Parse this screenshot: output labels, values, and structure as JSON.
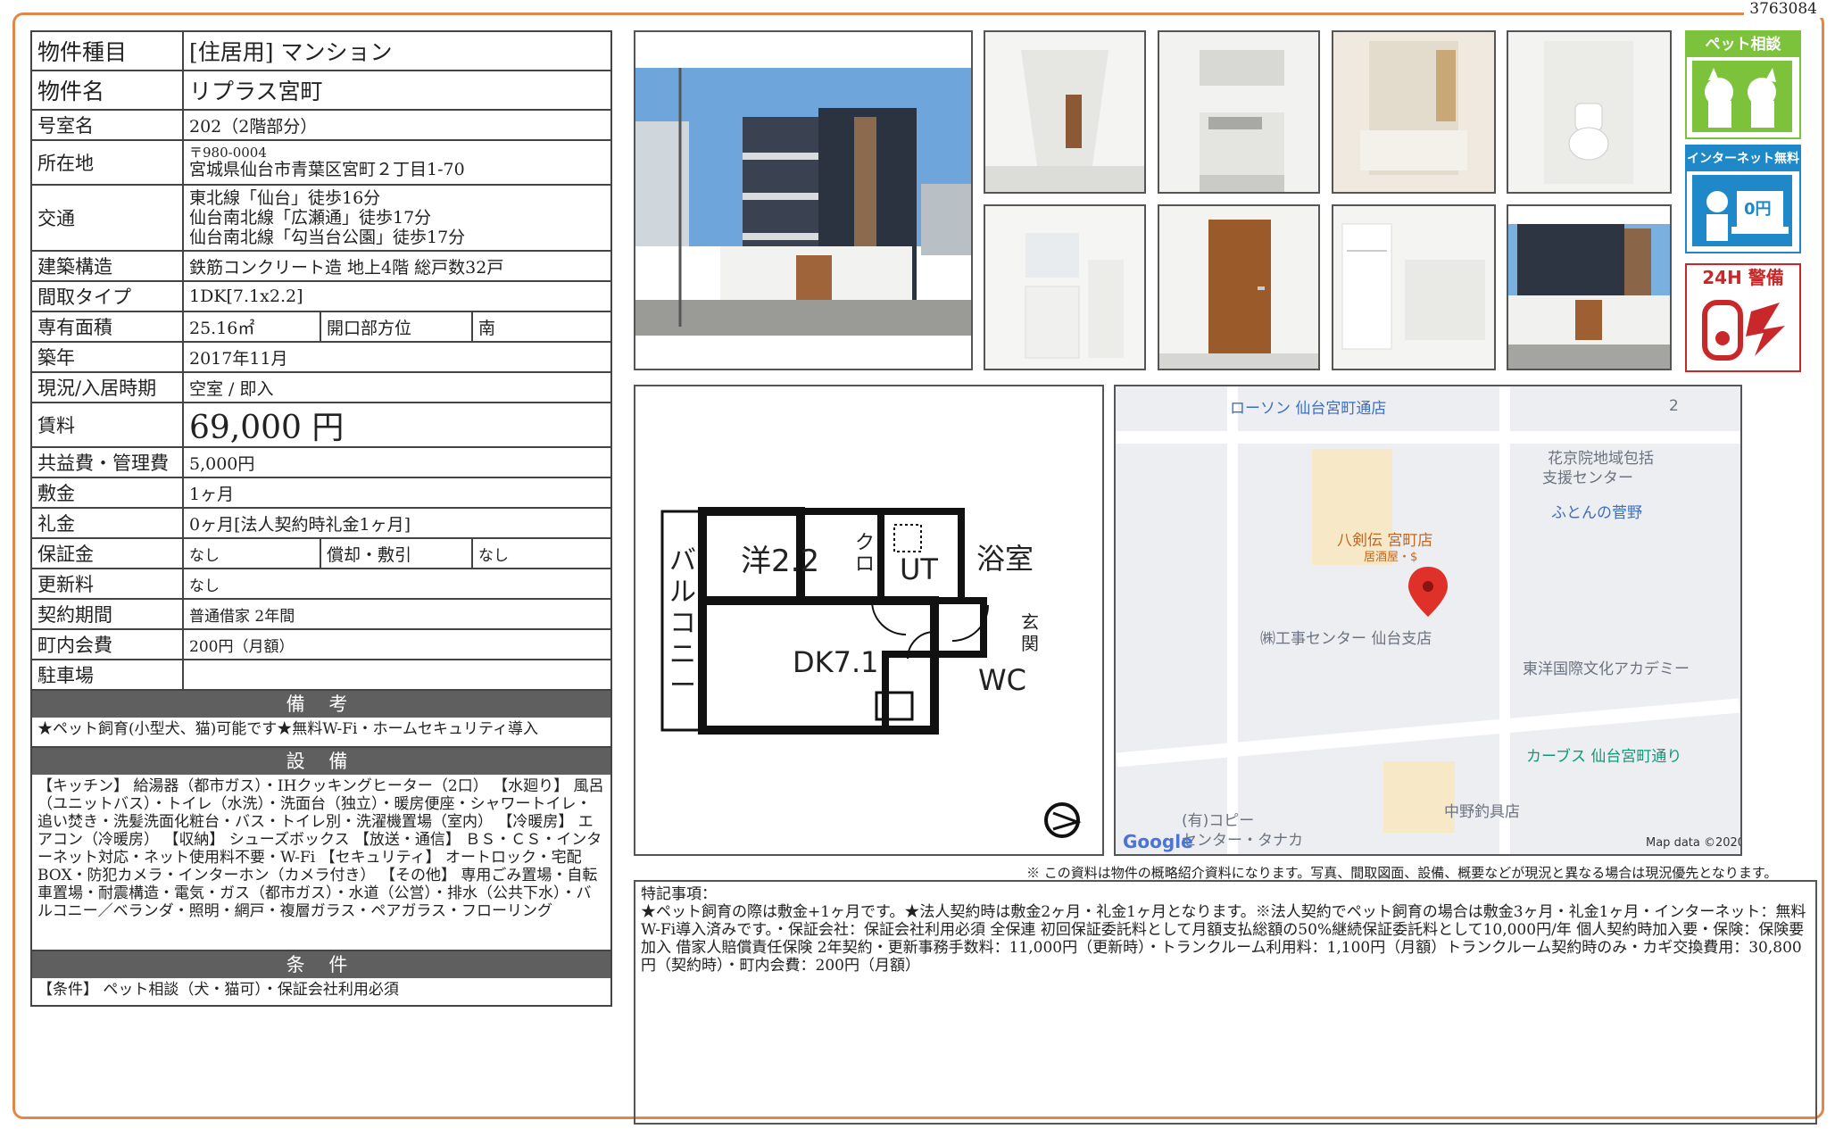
{
  "doc_id": "3763084",
  "property": {
    "type_label": "物件種目",
    "type_value": "[住居用] マンション",
    "name_label": "物件名",
    "name_value": "リプラス宮町",
    "room_label": "号室名",
    "room_value": "202（2階部分）",
    "address_label": "所在地",
    "postal": "〒980-0004",
    "address": "宮城県仙台市青葉区宮町２丁目1-70",
    "transit_label": "交通",
    "transit": [
      "東北線「仙台」徒歩16分",
      "仙台南北線「広瀬通」徒歩17分",
      "仙台南北線「勾当台公園」徒歩17分"
    ],
    "structure_label": "建築構造",
    "structure_value": "鉄筋コンクリート造 地上4階 総戸数32戸",
    "layout_label": "間取タイプ",
    "layout_value": "1DK[7.1x2.2]",
    "area_label": "専有面積",
    "area_value": "25.16㎡",
    "direction_label": "開口部方位",
    "direction_value": "南",
    "built_label": "築年",
    "built_value": "2017年11月",
    "status_label": "現況/入居時期",
    "status_value": "空室 / 即入",
    "rent_label": "賃料",
    "rent_value": "69,000 円",
    "fee_label": "共益費・管理費",
    "fee_value": "5,000円",
    "deposit_label": "敷金",
    "deposit_value": "1ヶ月",
    "keymoney_label": "礼金",
    "keymoney_value": "0ヶ月[法人契約時礼金1ヶ月]",
    "guarantee_label": "保証金",
    "guarantee_value": "なし",
    "amort_label": "償却・敷引",
    "amort_value": "なし",
    "renewal_label": "更新料",
    "renewal_value": "なし",
    "contract_label": "契約期間",
    "contract_value": "普通借家 2年間",
    "town_label": "町内会費",
    "town_value": "200円（月額）",
    "parking_label": "駐車場",
    "parking_value": ""
  },
  "sections": {
    "bikou_title": "備 考",
    "bikou_text": "★ペット飼育(小型犬、猫)可能です★無料W-Fi・ホームセキュリティ導入",
    "setsubi_title": "設 備",
    "setsubi_text": "【キッチン】 給湯器（都市ガス）・IHクッキングヒーター（2口） 【水廻り】 風呂（ユニットバス）・トイレ（水洗）・洗面台（独立）・暖房便座・シャワートイレ・追い焚き・洗髪洗面化粧台・バス・トイレ別・洗濯機置場（室内） 【冷暖房】 エアコン（冷暖房） 【収納】 シューズボックス 【放送・通信】 ＢＳ・ＣＳ・インターネット対応・ネット使用料不要・W-Fi 【セキュリティ】 オートロック・宅配BOX・防犯カメラ・インターホン（カメラ付き） 【その他】 専用ごみ置場・自転車置場・耐震構造・電気・ガス（都市ガス）・水道（公営）・排水（公共下水）・バルコニー／ベランダ・照明・網戸・複層ガラス・ペアガラス・フローリング",
    "jouken_title": "条 件",
    "jouken_text": "【条件】 ペット相談（犬・猫可）・保証会社利用必須"
  },
  "badges": {
    "pet": "ペット相談",
    "internet": "インターネット無料",
    "internet_price": "0円",
    "security": "24H 警備"
  },
  "floorplan": {
    "balcony": "バルコニー",
    "western": "洋2.2",
    "closet": "クロ",
    "ut": "UT",
    "bath": "浴室",
    "entrance": "玄関",
    "dk": "DK7.1",
    "wc": "WC"
  },
  "map": {
    "labels": [
      "ローソン 仙台宮町通店",
      "花京院地域包括",
      "支援センター",
      "ふとんの菅野",
      "八剣伝 宮町店",
      "居酒屋・$",
      "㈱工事センター 仙台支店",
      "東洋国際文化アカデミー",
      "カーブス 仙台宮町通り",
      "中野釣具店",
      "(有)コピー",
      "センター・タナカ",
      "2"
    ],
    "google": "Google",
    "copyright": "Map data ©2020"
  },
  "note": "※ この資料は物件の概略紹介資料になります。写真、間取図面、設備、概要などが現況と異なる場合は現況優先となります。",
  "remarks": {
    "title": "特記事項：",
    "text": "★ペット飼育の際は敷金+1ヶ月です。★法人契約時は敷金2ヶ月・礼金1ヶ月となります。※法人契約でペット飼育の場合は敷金3ヶ月・礼金1ヶ月・インターネット：無料W-Fi導入済みです。・保証会社：保証会社利用必須 全保連 初回保証委託料として月額支払総額の50%継続保証委託料として10,000円/年 個人契約時加入要・保険：保険要加入 借家人賠償責任保険 2年契約・更新事務手数料：11,000円（更新時）・トランクルーム利用料：1,100円（月額）トランクルーム契約時のみ・カギ交換費用：30,800円（契約時）・町内会費：200円（月額）"
  },
  "colors": {
    "frame": "#e0884a",
    "pet_badge": "#7cc23a",
    "internet_badge": "#1e88c8",
    "security_badge": "#c8282a",
    "section_head": "#5f5f5f"
  }
}
